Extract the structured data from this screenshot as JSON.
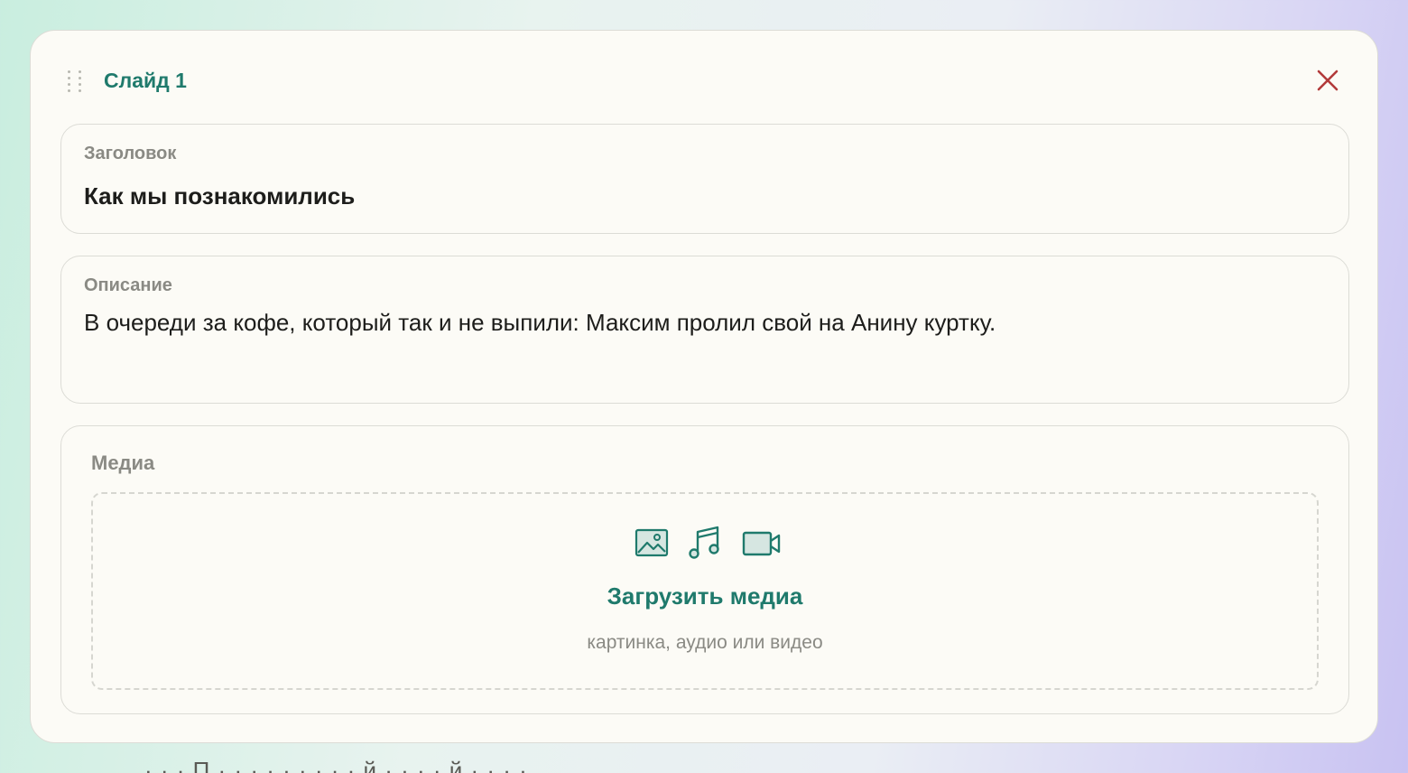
{
  "slide": {
    "title": "Слайд 1",
    "drag_icon": "drag-handle-icon",
    "close_icon": "close-icon",
    "accent_color": "#1f7a6c",
    "close_color": "#b23a3a"
  },
  "title_field": {
    "label": "Заголовок",
    "value": "Как мы познакомились"
  },
  "description_field": {
    "label": "Описание",
    "value": "В очереди за кофе, который так и не выпили: Максим пролил свой на Анину куртку."
  },
  "media": {
    "label": "Медиа",
    "icons": [
      "image-icon",
      "music-icon",
      "video-icon"
    ],
    "upload_label": "Загрузить медиа",
    "hint": "картинка, аудио или видео"
  },
  "footer": {
    "partial_text": "· · ·  П  ·  ·  ·  ·  ·  ·  ·  ·  ·  й  ·  ·  ·  ·  й ·  ·  ·  ·"
  }
}
